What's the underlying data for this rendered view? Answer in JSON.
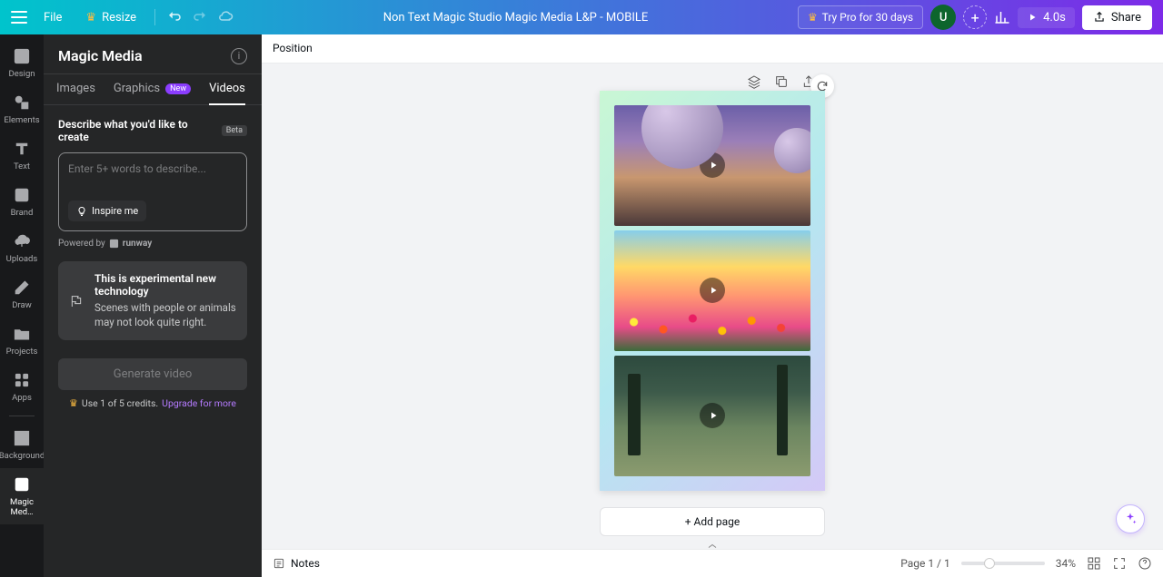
{
  "topbar": {
    "file": "File",
    "resize": "Resize",
    "doc_title": "Non Text Magic Studio Magic Media L&P - MOBILE",
    "try_pro": "Try Pro for 30 days",
    "avatar_initial": "U",
    "play_time": "4.0s",
    "share": "Share"
  },
  "rail": {
    "items": [
      {
        "label": "Design",
        "icon": "design"
      },
      {
        "label": "Elements",
        "icon": "elements"
      },
      {
        "label": "Text",
        "icon": "text"
      },
      {
        "label": "Brand",
        "icon": "brand"
      },
      {
        "label": "Uploads",
        "icon": "uploads"
      },
      {
        "label": "Draw",
        "icon": "draw"
      },
      {
        "label": "Projects",
        "icon": "projects"
      },
      {
        "label": "Apps",
        "icon": "apps"
      }
    ],
    "secondary": [
      {
        "label": "Background",
        "icon": "background"
      },
      {
        "label": "Magic Med…",
        "icon": "magic"
      }
    ]
  },
  "panel": {
    "title": "Magic Media",
    "tabs": {
      "images": "Images",
      "graphics": "Graphics",
      "graphics_badge": "New",
      "videos": "Videos"
    },
    "describe_label": "Describe what you'd like to create",
    "beta": "Beta",
    "placeholder": "Enter 5+ words to describe...",
    "inspire": "Inspire me",
    "powered_by": "Powered by",
    "provider": "runway",
    "info_title": "This is experimental new technology",
    "info_body": "Scenes with people or animals may not look quite right.",
    "generate": "Generate video",
    "credits": "Use 1 of 5 credits.",
    "upgrade": "Upgrade for more"
  },
  "canvas": {
    "position": "Position",
    "add_page": "+ Add page"
  },
  "bottom": {
    "notes": "Notes",
    "page_indicator": "Page 1 / 1",
    "zoom": "34%"
  }
}
